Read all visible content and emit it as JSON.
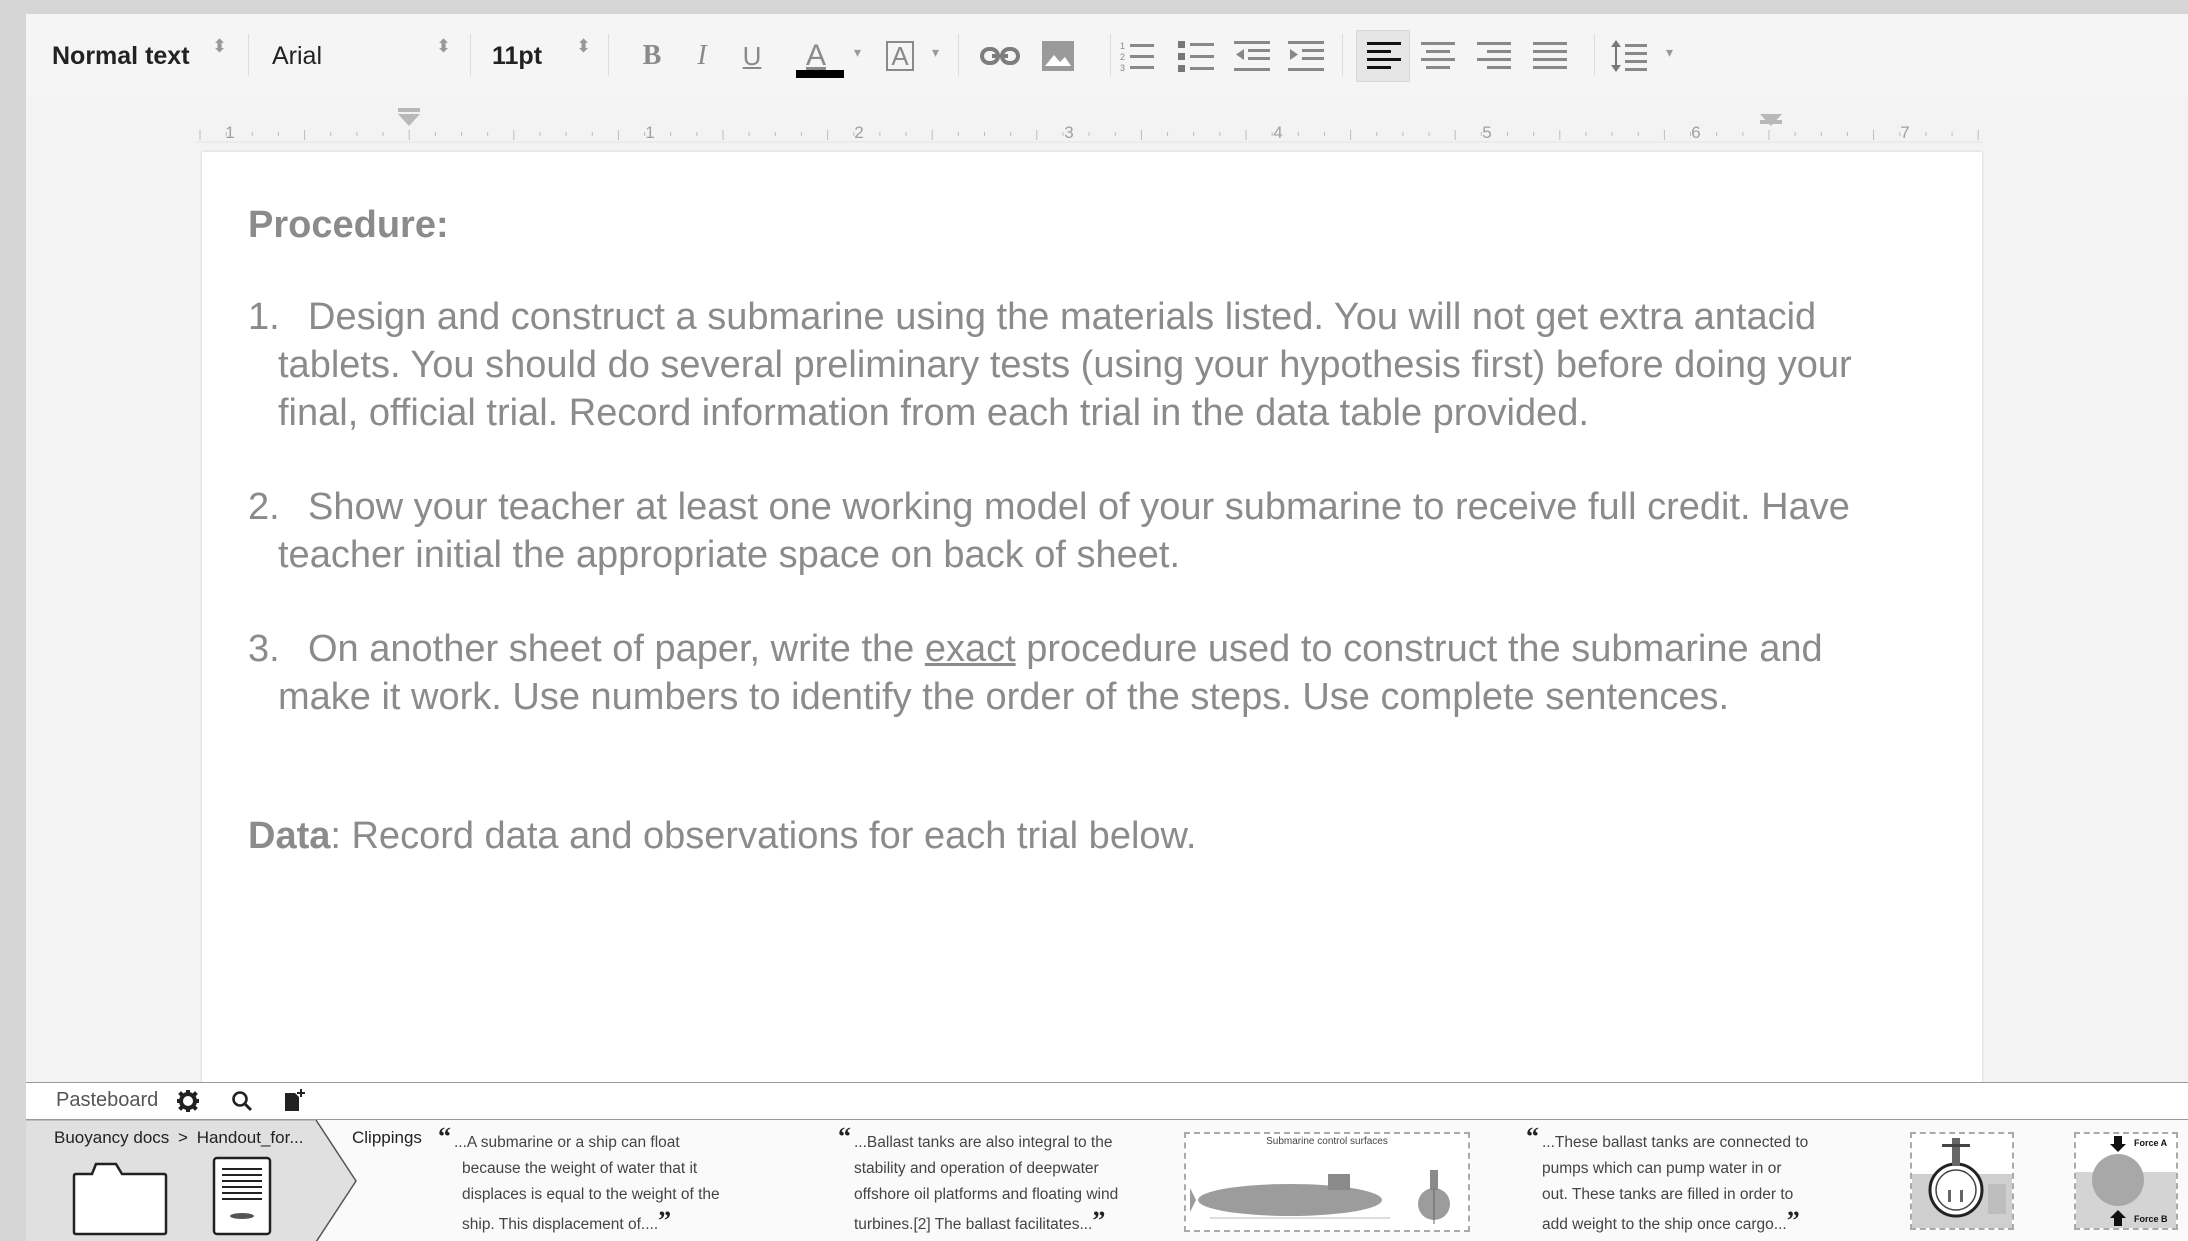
{
  "toolbar": {
    "style_select": "Normal text",
    "font_select": "Arial",
    "size_select": "11pt",
    "icons": [
      "bold-icon",
      "italic-icon",
      "underline-icon",
      "text-color-icon",
      "highlight-icon",
      "link-icon",
      "image-icon",
      "numbered-list-icon",
      "bulleted-list-icon",
      "decrease-indent-icon",
      "increase-indent-icon",
      "align-left-icon",
      "align-center-icon",
      "align-right-icon",
      "justify-icon",
      "line-spacing-icon"
    ],
    "bold_label": "B",
    "italic_label": "I",
    "underline_label": "U",
    "text_color_label": "A",
    "highlight_label": "A",
    "text_color": "#000000"
  },
  "ruler": {
    "labels": [
      "1",
      "1",
      "2",
      "3",
      "4",
      "5",
      "6",
      "7"
    ]
  },
  "document": {
    "heading": "Procedure:",
    "steps": [
      {
        "num": "1.",
        "text": "Design and construct a submarine using the materials listed. You will not get extra antacid tablets. You should do several preliminary tests (using your hypothesis first) before doing your final, official trial. Record information from each trial in the data table provided."
      },
      {
        "num": "2.",
        "text": "Show your teacher at least one working model of your submarine to receive full credit. Have teacher initial the appropriate space on back of sheet."
      },
      {
        "num": "3.",
        "pre": "On another sheet of paper, write the ",
        "underlined": "exact",
        "post": " procedure used to construct the submarine and make it work. Use numbers to identify the order of the steps. Use complete sentences."
      }
    ],
    "data_label": "Data",
    "data_text": ": Record data and observations for each trial below.",
    "text_color": "#8b8b8b"
  },
  "pasteboard": {
    "title": "Pasteboard",
    "header_icons": [
      "gear-icon",
      "search-icon",
      "new-document-icon"
    ],
    "breadcrumb_folder": "Buoyancy docs",
    "breadcrumb_separator": ">",
    "breadcrumb_doc": "Handout_for...",
    "clippings_label": "Clippings",
    "quotes": [
      {
        "open": "“",
        "lines": [
          "...A submarine or a ship can float",
          "because the weight of water that it",
          "displaces is equal to the weight of the",
          "ship. This displacement of...."
        ],
        "close": "”"
      },
      {
        "open": "“",
        "lines": [
          "...Ballast tanks are also integral to the",
          "stability and operation of deepwater",
          "offshore oil platforms and floating wind",
          "turbines.[2] The ballast facilitates..."
        ],
        "close": "”"
      },
      {
        "open": "“",
        "lines": [
          "...These ballast tanks are connected to",
          "pumps which can pump water in or",
          "out. These tanks are filled in order to",
          "add weight to the ship once cargo..."
        ],
        "close": "”"
      }
    ],
    "image_clips": [
      {
        "caption": "Submarine control surfaces"
      },
      {
        "caption": ""
      },
      {
        "caption_top": "Force A",
        "caption_bottom": "Force B"
      }
    ]
  }
}
